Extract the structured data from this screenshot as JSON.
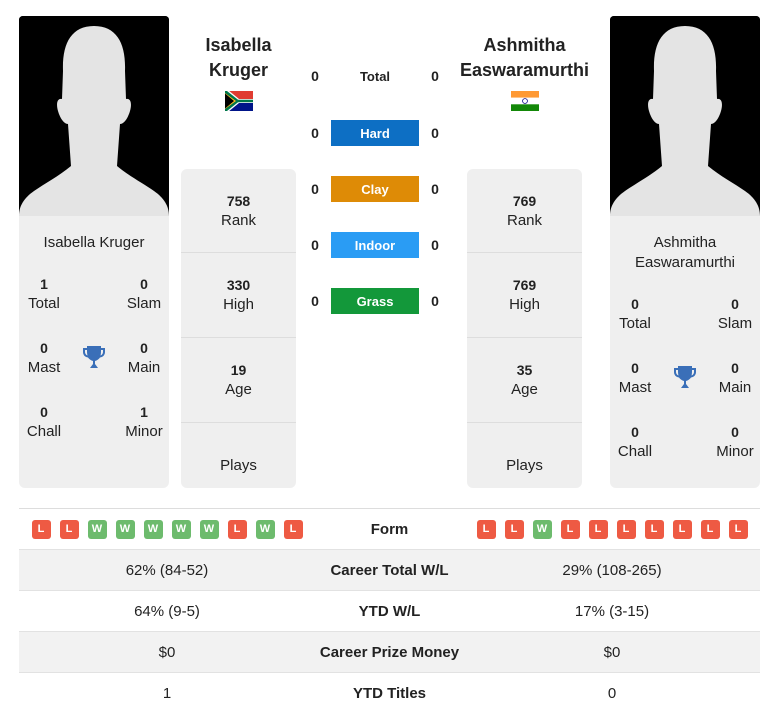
{
  "player1": {
    "name_line1": "Isabella",
    "name_line2": "Kruger",
    "card_name": "Isabella Kruger",
    "country_flag": "south-africa-flag",
    "titles": {
      "total": {
        "value": "1",
        "label": "Total"
      },
      "slam": {
        "value": "0",
        "label": "Slam"
      },
      "mast": {
        "value": "0",
        "label": "Mast"
      },
      "main": {
        "value": "0",
        "label": "Main"
      },
      "chall": {
        "value": "0",
        "label": "Chall"
      },
      "minor": {
        "value": "1",
        "label": "Minor"
      }
    },
    "stats": {
      "rank": {
        "value": "758",
        "label": "Rank"
      },
      "high": {
        "value": "330",
        "label": "High"
      },
      "age": {
        "value": "19",
        "label": "Age"
      },
      "plays": {
        "value": "",
        "label": "Plays"
      }
    },
    "form": [
      "L",
      "L",
      "W",
      "W",
      "W",
      "W",
      "W",
      "L",
      "W",
      "L"
    ]
  },
  "player2": {
    "name_line1": "Ashmitha",
    "name_line2": "Easwaramurthi",
    "card_name_line1": "Ashmitha",
    "card_name_line2": "Easwaramurthi",
    "country_flag": "india-flag",
    "titles": {
      "total": {
        "value": "0",
        "label": "Total"
      },
      "slam": {
        "value": "0",
        "label": "Slam"
      },
      "mast": {
        "value": "0",
        "label": "Mast"
      },
      "main": {
        "value": "0",
        "label": "Main"
      },
      "chall": {
        "value": "0",
        "label": "Chall"
      },
      "minor": {
        "value": "0",
        "label": "Minor"
      }
    },
    "stats": {
      "rank": {
        "value": "769",
        "label": "Rank"
      },
      "high": {
        "value": "769",
        "label": "High"
      },
      "age": {
        "value": "35",
        "label": "Age"
      },
      "plays": {
        "value": "",
        "label": "Plays"
      }
    },
    "form": [
      "L",
      "L",
      "W",
      "L",
      "L",
      "L",
      "L",
      "L",
      "L",
      "L"
    ]
  },
  "h2h": [
    {
      "label": "Total",
      "p1": "0",
      "p2": "0",
      "color": ""
    },
    {
      "label": "Hard",
      "p1": "0",
      "p2": "0",
      "color": "#0d6fc4"
    },
    {
      "label": "Clay",
      "p1": "0",
      "p2": "0",
      "color": "#de8b06"
    },
    {
      "label": "Indoor",
      "p1": "0",
      "p2": "0",
      "color": "#2a9cf4"
    },
    {
      "label": "Grass",
      "p1": "0",
      "p2": "0",
      "color": "#13983a"
    }
  ],
  "comparison": {
    "form_label": "Form",
    "rows": [
      {
        "label": "Career Total W/L",
        "p1": "62% (84-52)",
        "p2": "29% (108-265)"
      },
      {
        "label": "YTD W/L",
        "p1": "64% (9-5)",
        "p2": "17% (3-15)"
      },
      {
        "label": "Career Prize Money",
        "p1": "$0",
        "p2": "$0"
      },
      {
        "label": "YTD Titles",
        "p1": "1",
        "p2": "0"
      }
    ]
  },
  "colors": {
    "win": "#6dbb6d",
    "loss": "#ee5a43",
    "trophy": "#3a6fb8"
  }
}
